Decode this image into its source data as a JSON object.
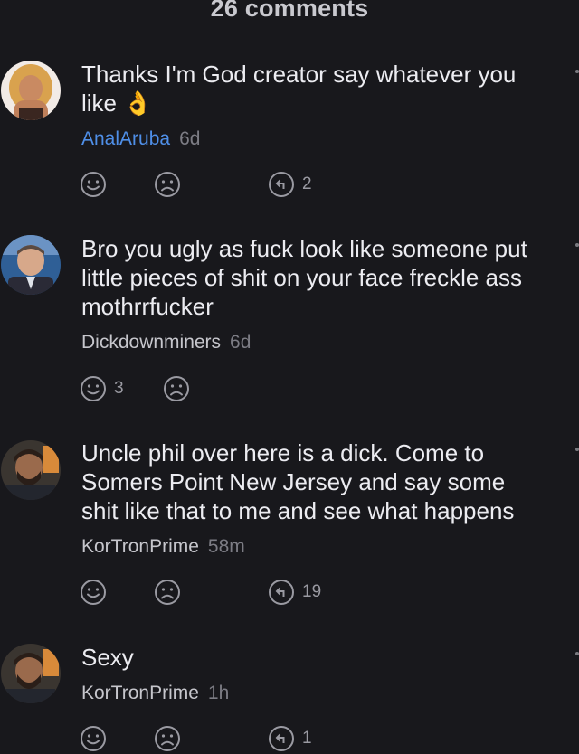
{
  "header": {
    "title": "26 comments"
  },
  "comments": [
    {
      "text": "Thanks I'm God creator say whatever you like 👌",
      "username": "AnalAruba",
      "time": "6d",
      "upvotes": "",
      "downvotes": "",
      "replies": "2"
    },
    {
      "text": "Bro you ugly as fuck look like someone put little pieces of shit on your face freckle ass mothrrfucker",
      "username": "Dickdownminers",
      "time": "6d",
      "upvotes": "3",
      "downvotes": "",
      "replies": ""
    },
    {
      "text": "Uncle phil over here is a dick. Come to Somers Point New Jersey and say some shit like that to me and see what happens",
      "username": "KorTronPrime",
      "time": "58m",
      "upvotes": "",
      "downvotes": "",
      "replies": "19"
    },
    {
      "text": "Sexy",
      "username": "KorTronPrime",
      "time": "1h",
      "upvotes": "",
      "downvotes": "",
      "replies": "1"
    }
  ],
  "colors": {
    "background": "#18181c",
    "highlight_username": "#4f8fe8",
    "icon": "#9a9aa2"
  }
}
